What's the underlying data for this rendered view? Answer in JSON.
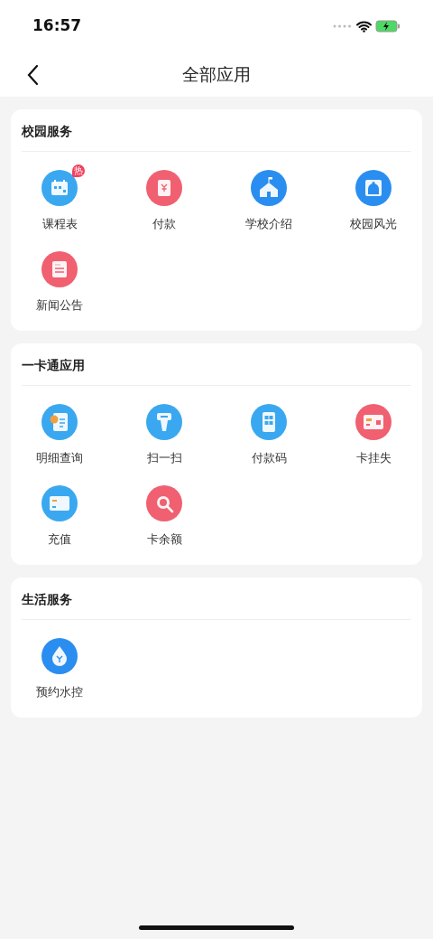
{
  "status_bar": {
    "time": "16:57"
  },
  "nav": {
    "title": "全部应用"
  },
  "sections": [
    {
      "title": "校园服务",
      "apps": [
        {
          "label": "课程表",
          "color": "#3aa8f0",
          "badge": "热"
        },
        {
          "label": "付款",
          "color": "#f06070"
        },
        {
          "label": "学校介绍",
          "color": "#2a8ef0"
        },
        {
          "label": "校园风光",
          "color": "#2a8ef0"
        },
        {
          "label": "新闻公告",
          "color": "#f06070"
        }
      ]
    },
    {
      "title": "一卡通应用",
      "apps": [
        {
          "label": "明细查询",
          "color": "#3aa8f0"
        },
        {
          "label": "扫一扫",
          "color": "#3aa8f0"
        },
        {
          "label": "付款码",
          "color": "#3aa8f0"
        },
        {
          "label": "卡挂失",
          "color": "#f06070"
        },
        {
          "label": "充值",
          "color": "#3aa8f0"
        },
        {
          "label": "卡余额",
          "color": "#f06070"
        }
      ]
    },
    {
      "title": "生活服务",
      "apps": [
        {
          "label": "预约水控",
          "color": "#2a8ef0"
        }
      ]
    }
  ]
}
